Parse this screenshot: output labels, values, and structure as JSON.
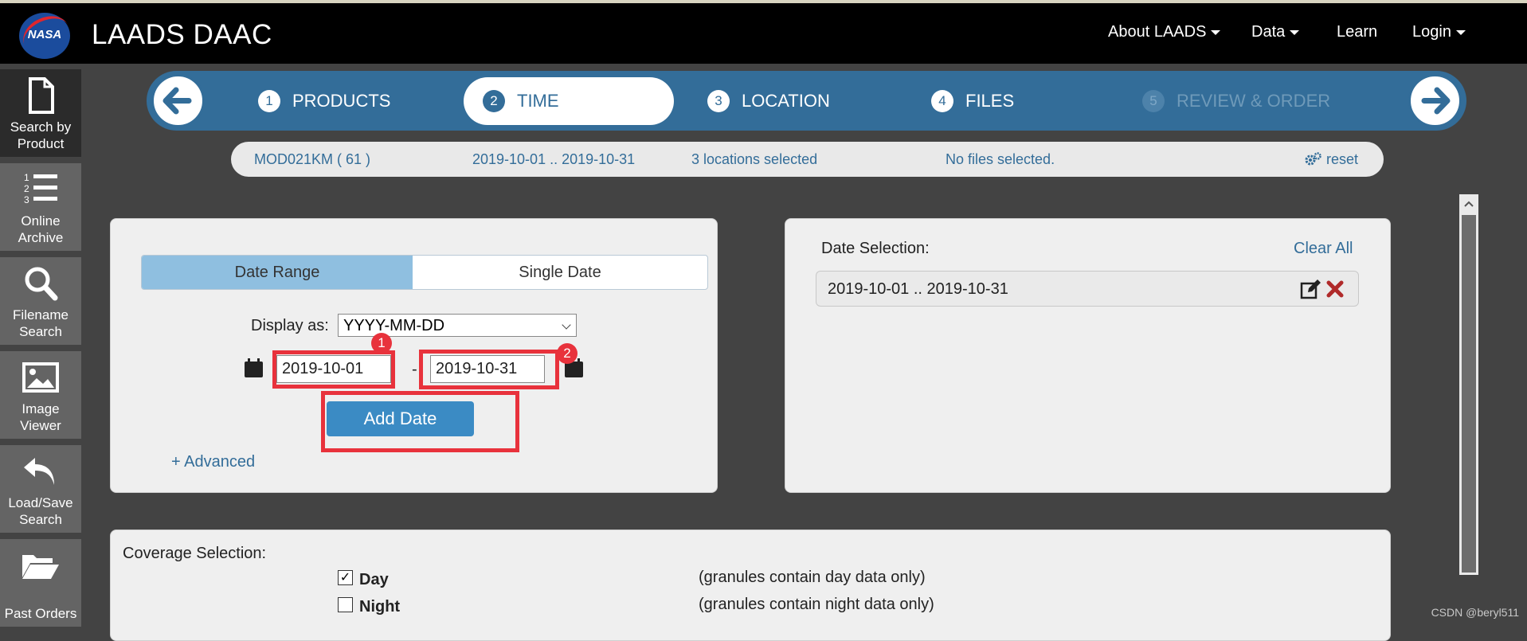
{
  "header": {
    "logo_text": "NASA",
    "app_title": "LAADS DAAC",
    "nav": [
      {
        "label": "About LAADS"
      },
      {
        "label": "Data"
      },
      {
        "label": "Learn"
      },
      {
        "label": "Login"
      }
    ]
  },
  "sidebar": {
    "items": [
      {
        "label_line1": "Search by",
        "label_line2": "Product",
        "icon": "document-icon",
        "active": true
      },
      {
        "label_line1": "Online",
        "label_line2": "Archive",
        "icon": "numbered-list-icon"
      },
      {
        "label_line1": "Filename",
        "label_line2": "Search",
        "icon": "search-icon"
      },
      {
        "label_line1": "Image",
        "label_line2": "Viewer",
        "icon": "image-icon"
      },
      {
        "label_line1": "Load/Save",
        "label_line2": "Search",
        "icon": "undo-icon"
      },
      {
        "label_line1": "Past Orders",
        "label_line2": "",
        "icon": "folder-open-icon"
      }
    ]
  },
  "stepper": {
    "steps": [
      {
        "num": "1",
        "label": "PRODUCTS"
      },
      {
        "num": "2",
        "label": "TIME",
        "active": true
      },
      {
        "num": "3",
        "label": "LOCATION"
      },
      {
        "num": "4",
        "label": "FILES"
      },
      {
        "num": "5",
        "label": "REVIEW & ORDER",
        "disabled": true
      }
    ]
  },
  "summary": {
    "product": "MOD021KM ( 61 )",
    "time": "2019-10-01 .. 2019-10-31",
    "locations": "3 locations selected",
    "files": "No files selected.",
    "reset": "reset"
  },
  "time_panel": {
    "tab_range": "Date Range",
    "tab_single": "Single Date",
    "display_as_label": "Display as:",
    "display_as_value": "YYYY-MM-DD",
    "start_date": "2019-10-01",
    "end_date": "2019-10-31",
    "date_separator": "-",
    "add_button": "Add Date",
    "advanced_link": "+ Advanced",
    "badge1": "1",
    "badge2": "2"
  },
  "selection_panel": {
    "title": "Date Selection:",
    "clear_all": "Clear All",
    "entries": [
      "2019-10-01 .. 2019-10-31"
    ]
  },
  "coverage": {
    "title": "Coverage Selection:",
    "options": [
      {
        "label": "Day",
        "checked": true,
        "description": "(granules contain day data only)"
      },
      {
        "label": "Night",
        "checked": false,
        "description": "(granules contain night data only)"
      }
    ]
  },
  "watermark": "CSDN @beryl511",
  "colors": {
    "primary": "#336d99",
    "accent_button": "#3b8bc4",
    "highlight_red": "#e8323c",
    "active_tab": "#8fbfe0"
  }
}
